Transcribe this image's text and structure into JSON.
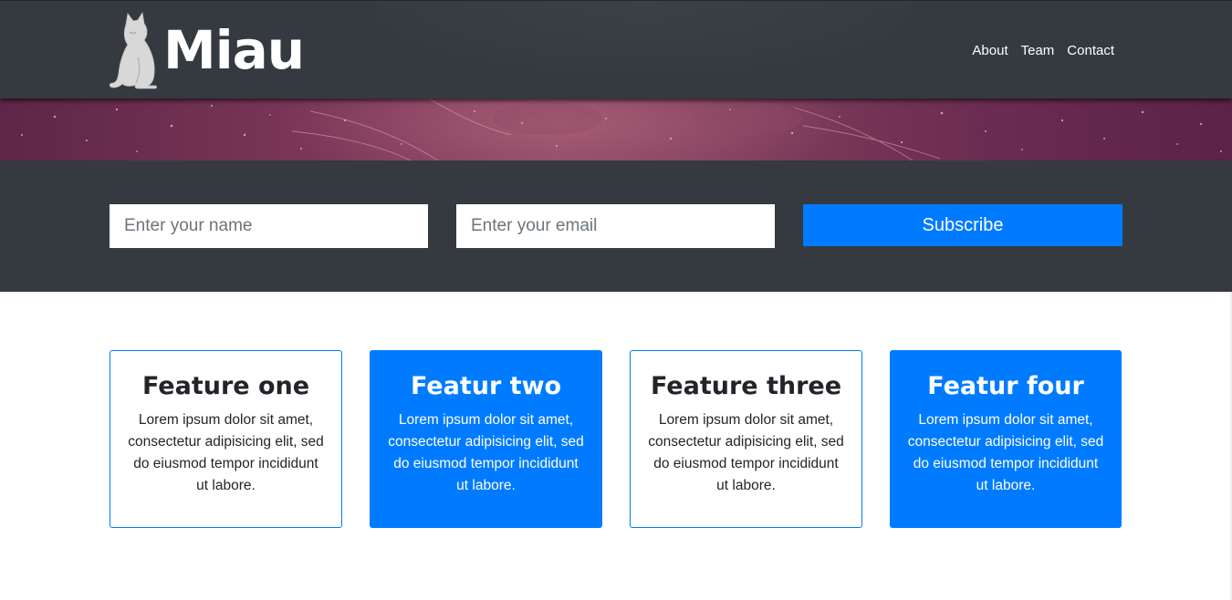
{
  "brand": {
    "name": "Miau",
    "logo_icon": "cat-icon"
  },
  "nav": {
    "items": [
      {
        "label": "About"
      },
      {
        "label": "Team"
      },
      {
        "label": "Contact"
      }
    ]
  },
  "subscribe": {
    "name_placeholder": "Enter your name",
    "email_placeholder": "Enter your email",
    "button_label": "Subscribe"
  },
  "features": [
    {
      "title": "Feature one",
      "text": "Lorem ipsum dolor sit amet, consectetur adipisicing elit, sed do eiusmod tempor incididunt ut labore.",
      "style": "outline"
    },
    {
      "title": "Featur two",
      "text": "Lorem ipsum dolor sit amet, consectetur adipisicing elit, sed do eiusmod tempor incididunt ut labore.",
      "style": "filled"
    },
    {
      "title": "Feature three",
      "text": "Lorem ipsum dolor sit amet, consectetur adipisicing elit, sed do eiusmod tempor incididunt ut labore.",
      "style": "outline"
    },
    {
      "title": "Featur four",
      "text": "Lorem ipsum dolor sit amet, consectetur adipisicing elit, sed do eiusmod tempor incididunt ut labore.",
      "style": "filled"
    }
  ],
  "colors": {
    "dark": "#343a40",
    "primary": "#007bff",
    "hero": "#7a3658",
    "white": "#ffffff"
  }
}
